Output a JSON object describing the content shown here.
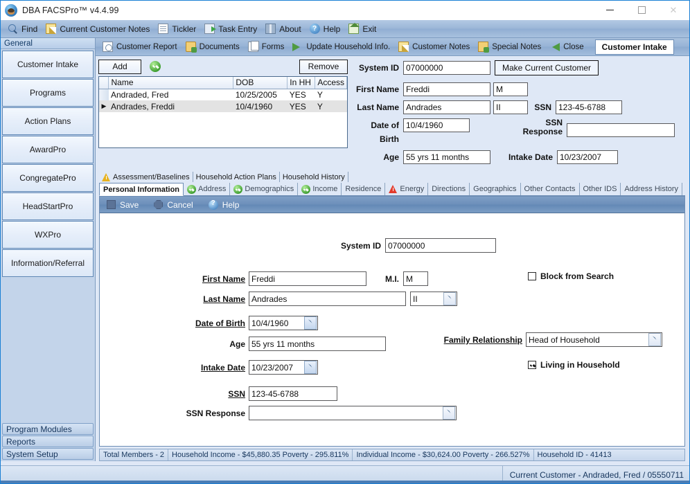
{
  "window": {
    "title": "DBA FACSPro™ v4.4.99",
    "icon": "app-globe-icon",
    "minimize": "–",
    "maximize": "□",
    "close": "✕"
  },
  "main_toolbar": [
    {
      "label": "Find",
      "icon": "search-icon"
    },
    {
      "label": "Current Customer Notes",
      "icon": "note-icon"
    },
    {
      "label": "Tickler",
      "icon": "document-icon"
    },
    {
      "label": "Task Entry",
      "icon": "task-icon"
    },
    {
      "label": "About",
      "icon": "book-icon"
    },
    {
      "label": "Help",
      "icon": "help-icon"
    },
    {
      "label": "Exit",
      "icon": "home-exit-icon"
    }
  ],
  "sub_toolbar": {
    "items": [
      {
        "label": "Customer Report",
        "icon": "report-icon"
      },
      {
        "label": "Documents",
        "icon": "folder-icon"
      },
      {
        "label": "Forms",
        "icon": "forms-icon"
      },
      {
        "label": "Update Household Info.",
        "icon": "green-right-arrow-icon"
      },
      {
        "label": "Customer Notes",
        "icon": "note-icon"
      },
      {
        "label": "Special Notes",
        "icon": "special-notes-icon"
      },
      {
        "label": "Close",
        "icon": "green-left-arrow-icon"
      }
    ],
    "active_chip": "Customer Intake"
  },
  "sidebar": {
    "header": "General",
    "items": [
      {
        "label": "Customer Intake"
      },
      {
        "label": "Programs"
      },
      {
        "label": "Action Plans"
      },
      {
        "label": "AwardPro"
      },
      {
        "label": "CongregatePro"
      },
      {
        "label": "HeadStartPro"
      },
      {
        "label": "WXPro"
      },
      {
        "label": "Information/Referral"
      }
    ],
    "bottom_items": [
      {
        "label": "Program Modules"
      },
      {
        "label": "Reports"
      },
      {
        "label": "System Setup"
      }
    ]
  },
  "household_grid": {
    "add_button": "Add",
    "remove_button": "Remove",
    "status_icon": "green-check-icon",
    "columns": [
      "Name",
      "DOB",
      "In HH",
      "Access"
    ],
    "rows": [
      {
        "marker": "",
        "name": "Andraded, Fred",
        "dob": "10/25/2005",
        "in_hh": "YES",
        "access": "Y",
        "selected": false
      },
      {
        "marker": "▶",
        "name": "Andrades, Freddi",
        "dob": "10/4/1960",
        "in_hh": "YES",
        "access": "Y",
        "selected": true
      }
    ]
  },
  "top_fields": {
    "system_id_label": "System ID",
    "system_id_value": "07000000",
    "make_current_button": "Make Current Customer",
    "first_name_label": "First Name",
    "first_name_value": "Freddi",
    "mi_value": "M",
    "last_name_label": "Last Name",
    "last_name_value": "Andrades",
    "suffix_value": "II",
    "ssn_label": "SSN",
    "ssn_value": "123-45-6788",
    "dob_label": "Date of Birth",
    "dob_value": "10/4/1960",
    "ssn_response_label": "SSN Response",
    "ssn_response_value": "",
    "age_label": "Age",
    "age_value": "55 yrs 11 months",
    "intake_date_label": "Intake Date",
    "intake_date_value": "10/23/2007"
  },
  "tabs_row1": [
    {
      "label": "Assessment/Baselines",
      "icon": "yellow-warning-icon"
    },
    {
      "label": "Household Action Plans",
      "icon": ""
    },
    {
      "label": "Household History",
      "icon": ""
    }
  ],
  "tabs_row2": [
    {
      "label": "Personal Information",
      "icon": "",
      "active": true
    },
    {
      "label": "Address",
      "icon": "green-check-icon",
      "active": false
    },
    {
      "label": "Demographics",
      "icon": "green-check-icon",
      "active": false
    },
    {
      "label": "Income",
      "icon": "green-check-icon",
      "active": false
    },
    {
      "label": "Residence",
      "icon": "",
      "active": false
    },
    {
      "label": "Energy",
      "icon": "red-warning-icon",
      "active": false
    },
    {
      "label": "Directions",
      "icon": "",
      "active": false
    },
    {
      "label": "Geographics",
      "icon": "",
      "active": false
    },
    {
      "label": "Other Contacts",
      "icon": "",
      "active": false
    },
    {
      "label": "Other IDS",
      "icon": "",
      "active": false
    },
    {
      "label": "Address History",
      "icon": "",
      "active": false
    }
  ],
  "form_toolbar": [
    {
      "label": "Save",
      "icon": "save-square-icon"
    },
    {
      "label": "Cancel",
      "icon": "cancel-octagon-icon"
    },
    {
      "label": "Help",
      "icon": "help-icon"
    }
  ],
  "form": {
    "system_id_label": "System ID",
    "system_id_value": "07000000",
    "first_name_label": "First Name",
    "first_name_value": "Freddi",
    "mi_label": "M.I.",
    "mi_value": "M",
    "last_name_label": "Last Name",
    "last_name_value": "Andrades",
    "suffix_value": "II",
    "dob_label": "Date of Birth",
    "dob_value": "10/4/1960",
    "age_label": "Age",
    "age_value": "55 yrs 11 months",
    "intake_date_label": "Intake Date",
    "intake_date_value": "10/23/2007",
    "ssn_label": "SSN",
    "ssn_value": "123-45-6788",
    "ssn_response_label": "SSN Response",
    "ssn_response_value": "",
    "block_from_search_label": "Block from Search",
    "block_from_search_checked": false,
    "family_relationship_label": "Family Relationship",
    "family_relationship_value": "Head of Household",
    "living_in_household_label": "Living in Household",
    "living_in_household_checked": true
  },
  "status_bar": {
    "total_members": "Total Members - 2",
    "household_income": "Household Income - $45,880.35  Poverty - 295.811%",
    "individual_income": "Individual Income - $30,624.00  Poverty - 266.527%",
    "household_id": "Household ID - 41413"
  },
  "bottom_bar": {
    "current_customer": "Current Customer - Andraded, Fred / 05550711"
  }
}
